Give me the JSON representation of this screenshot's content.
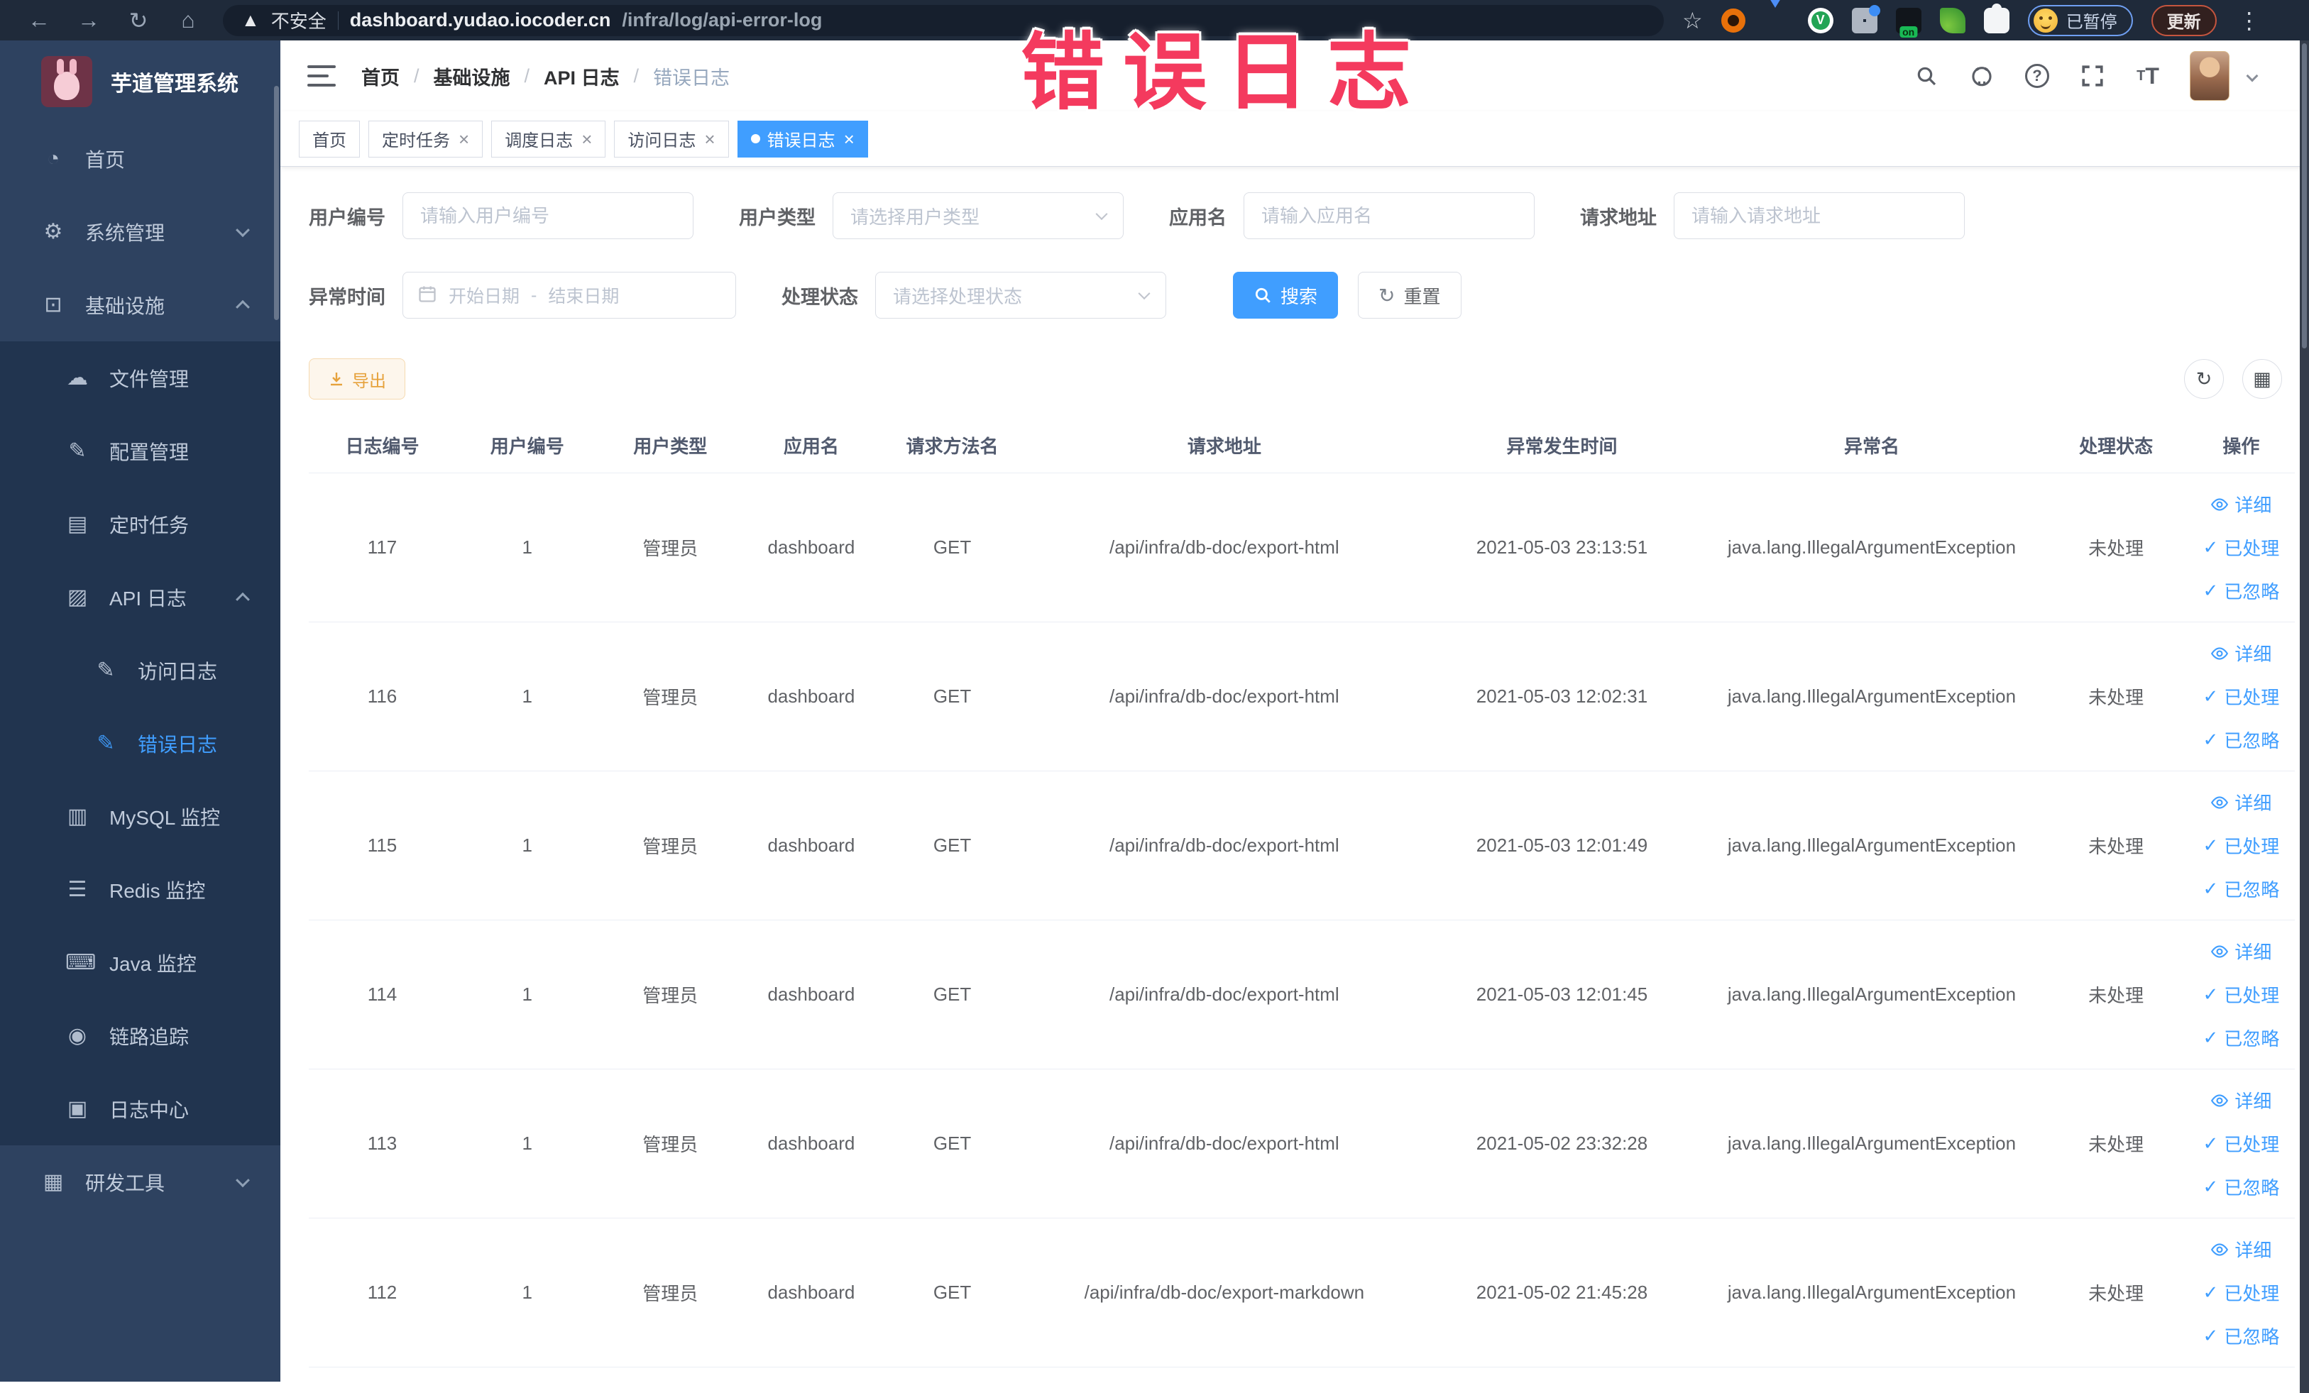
{
  "browser": {
    "security_label": "不安全",
    "url_domain": "dashboard.yudao.iocoder.cn",
    "url_path": "/infra/log/api-error-log",
    "paused_badge": "已暂停",
    "update_button": "更新"
  },
  "annotation": "错误日志",
  "colors": {
    "accent": "#409eff",
    "annotation": "#f43a5e",
    "sidebar": "#2e4260",
    "warning": "#e6a23c"
  },
  "sidebar": {
    "title": "芋道管理系统",
    "items": [
      {
        "label": "首页",
        "level": "top",
        "icon": "dashboard-icon"
      },
      {
        "label": "系统管理",
        "level": "top",
        "icon": "system-icon",
        "chevron": "down"
      },
      {
        "label": "基础设施",
        "level": "top",
        "icon": "infrastructure-icon",
        "chevron": "up"
      },
      {
        "label": "文件管理",
        "level": "sub",
        "icon": "file-icon"
      },
      {
        "label": "配置管理",
        "level": "sub",
        "icon": "config-icon"
      },
      {
        "label": "定时任务",
        "level": "sub",
        "icon": "job-icon"
      },
      {
        "label": "API 日志",
        "level": "sub",
        "icon": "api-log-icon",
        "chevron": "up"
      },
      {
        "label": "访问日志",
        "level": "nested",
        "icon": "access-log-icon"
      },
      {
        "label": "错误日志",
        "level": "nested",
        "icon": "error-log-icon",
        "active": true
      },
      {
        "label": "MySQL 监控",
        "level": "sub",
        "icon": "mysql-icon"
      },
      {
        "label": "Redis 监控",
        "level": "sub",
        "icon": "redis-icon"
      },
      {
        "label": "Java 监控",
        "level": "sub",
        "icon": "java-icon"
      },
      {
        "label": "链路追踪",
        "level": "sub",
        "icon": "trace-icon"
      },
      {
        "label": "日志中心",
        "level": "sub",
        "icon": "log-center-icon"
      },
      {
        "label": "研发工具",
        "level": "top",
        "icon": "devtools-icon",
        "chevron": "down"
      }
    ]
  },
  "breadcrumb": {
    "items": [
      "首页",
      "基础设施",
      "API 日志",
      "错误日志"
    ],
    "separator": "/"
  },
  "tabs": [
    {
      "label": "首页",
      "pinned": true
    },
    {
      "label": "定时任务"
    },
    {
      "label": "调度日志"
    },
    {
      "label": "访问日志"
    },
    {
      "label": "错误日志",
      "active": true
    }
  ],
  "tab_close_glyph": "×",
  "filters": {
    "user_id": {
      "label": "用户编号",
      "placeholder": "请输入用户编号"
    },
    "user_type": {
      "label": "用户类型",
      "placeholder": "请选择用户类型"
    },
    "app_name": {
      "label": "应用名",
      "placeholder": "请输入应用名"
    },
    "request_url": {
      "label": "请求地址",
      "placeholder": "请输入请求地址"
    },
    "exception_time": {
      "label": "异常时间",
      "start_placeholder": "开始日期",
      "separator": "-",
      "end_placeholder": "结束日期"
    },
    "process_status": {
      "label": "处理状态",
      "placeholder": "请选择处理状态"
    },
    "search_button": "搜索",
    "reset_button": "重置"
  },
  "toolbar": {
    "export_button": "导出"
  },
  "table": {
    "columns": [
      "日志编号",
      "用户编号",
      "用户类型",
      "应用名",
      "请求方法名",
      "请求地址",
      "异常发生时间",
      "异常名",
      "处理状态",
      "操作"
    ],
    "actions": [
      "详细",
      "已处理",
      "已忽略"
    ],
    "rows": [
      {
        "id": "117",
        "user_id": "1",
        "user_type": "管理员",
        "app": "dashboard",
        "method": "GET",
        "url": "/api/infra/db-doc/export-html",
        "time": "2021-05-03 23:13:51",
        "exception": "java.lang.IllegalArgumentException",
        "status": "未处理"
      },
      {
        "id": "116",
        "user_id": "1",
        "user_type": "管理员",
        "app": "dashboard",
        "method": "GET",
        "url": "/api/infra/db-doc/export-html",
        "time": "2021-05-03 12:02:31",
        "exception": "java.lang.IllegalArgumentException",
        "status": "未处理"
      },
      {
        "id": "115",
        "user_id": "1",
        "user_type": "管理员",
        "app": "dashboard",
        "method": "GET",
        "url": "/api/infra/db-doc/export-html",
        "time": "2021-05-03 12:01:49",
        "exception": "java.lang.IllegalArgumentException",
        "status": "未处理"
      },
      {
        "id": "114",
        "user_id": "1",
        "user_type": "管理员",
        "app": "dashboard",
        "method": "GET",
        "url": "/api/infra/db-doc/export-html",
        "time": "2021-05-03 12:01:45",
        "exception": "java.lang.IllegalArgumentException",
        "status": "未处理"
      },
      {
        "id": "113",
        "user_id": "1",
        "user_type": "管理员",
        "app": "dashboard",
        "method": "GET",
        "url": "/api/infra/db-doc/export-html",
        "time": "2021-05-02 23:32:28",
        "exception": "java.lang.IllegalArgumentException",
        "status": "未处理"
      },
      {
        "id": "112",
        "user_id": "1",
        "user_type": "管理员",
        "app": "dashboard",
        "method": "GET",
        "url": "/api/infra/db-doc/export-markdown",
        "time": "2021-05-02 21:45:28",
        "exception": "java.lang.IllegalArgumentException",
        "status": "未处理"
      }
    ]
  }
}
